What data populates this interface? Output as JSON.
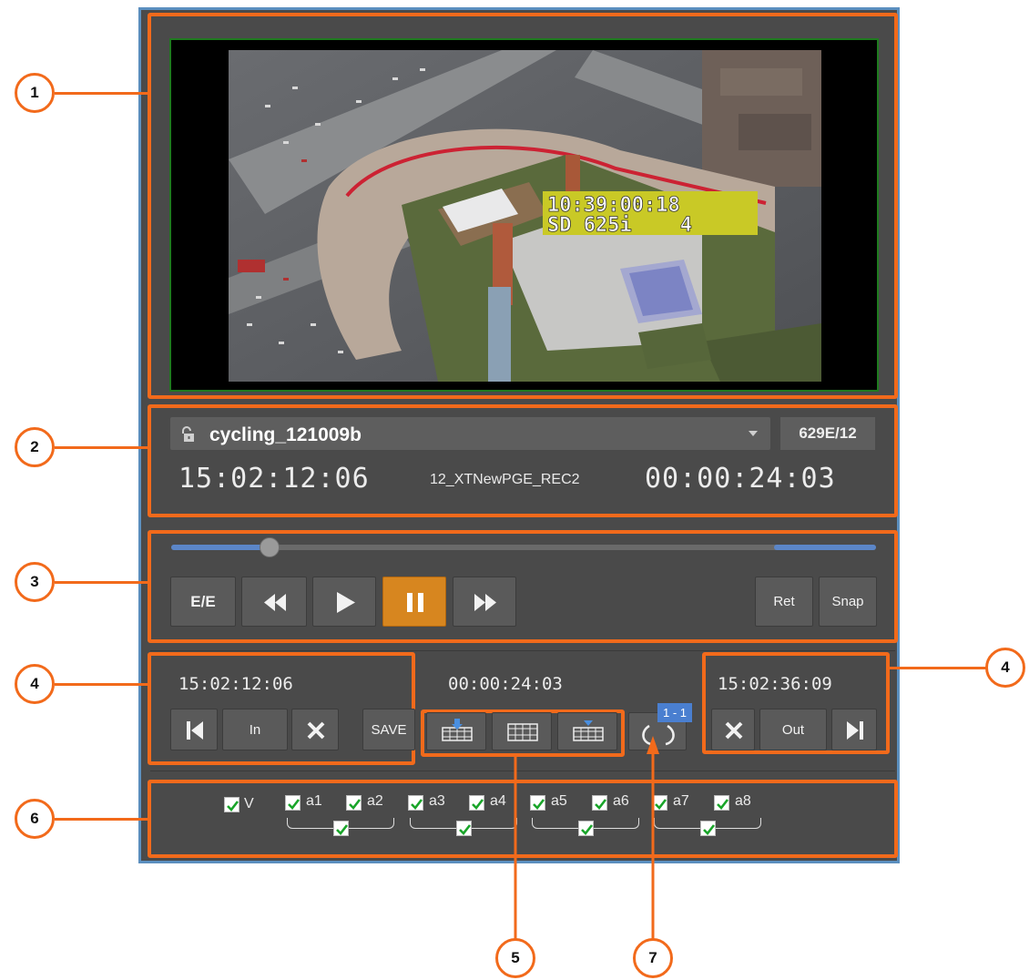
{
  "video": {
    "overlay_tc": "10:39:00:18",
    "overlay_fmt": "SD 625i    4"
  },
  "clip": {
    "name": "cycling_121009b",
    "badge": "629E/12",
    "tc_left": "15:02:12:06",
    "recorder": "12_XTNewPGE_REC2",
    "tc_right": "00:00:24:03"
  },
  "transport": {
    "ee_label": "E/E",
    "ret_label": "Ret",
    "snap_label": "Snap",
    "position_fraction": 0.14
  },
  "marks": {
    "in_tc": "15:02:12:06",
    "duration_tc": "00:00:24:03",
    "out_tc": "15:02:36:09",
    "in_label": "In",
    "out_label": "Out",
    "save_label": "SAVE",
    "mapping_label": "1 - 1"
  },
  "tracks": {
    "video": "V",
    "audio": [
      "a1",
      "a2",
      "a3",
      "a4",
      "a5",
      "a6",
      "a7",
      "a8"
    ]
  },
  "callouts": [
    "1",
    "2",
    "3",
    "4",
    "4",
    "5",
    "6",
    "7"
  ],
  "colors": {
    "accent": "#f26a1b",
    "pause_active": "#d7861f",
    "scrub_blue": "#5b86c8",
    "overlay_yellow": "#c9c926"
  }
}
